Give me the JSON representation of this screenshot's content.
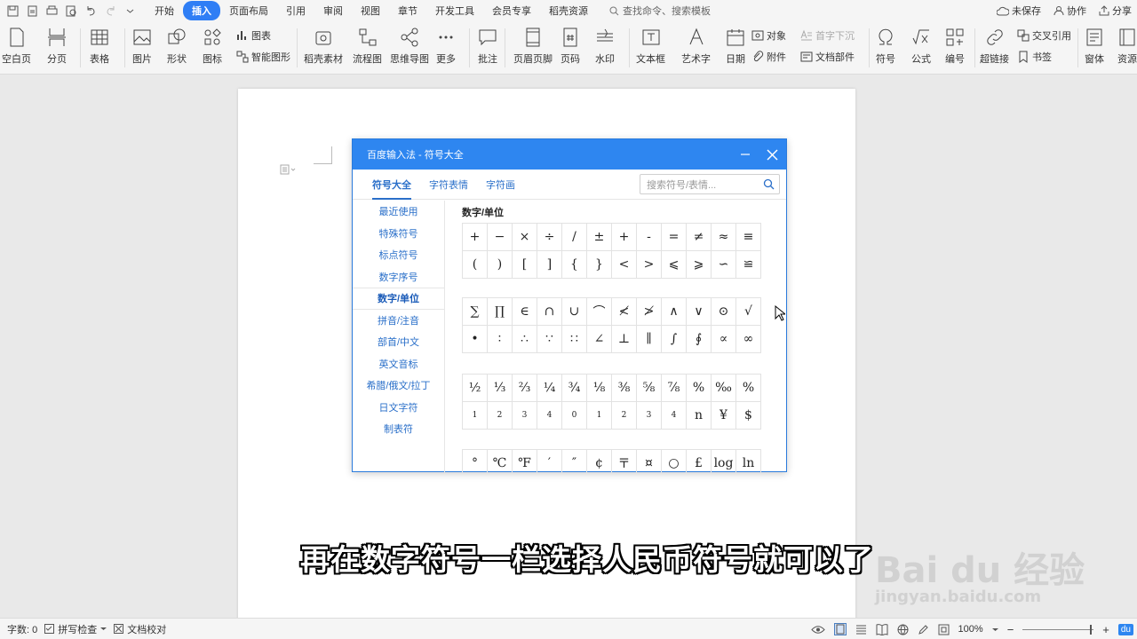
{
  "menubar": {
    "tabs": [
      "开始",
      "插入",
      "页面布局",
      "引用",
      "审阅",
      "视图",
      "章节",
      "开发工具",
      "会员专享",
      "稻壳资源"
    ],
    "active_tab": "插入",
    "search_placeholder": "查找命令、搜索模板",
    "unsaved": "未保存",
    "collab": "协作",
    "share": "分享"
  },
  "ribbon": {
    "blank_page": "空白页",
    "page_break": "分页",
    "table": "表格",
    "picture": "图片",
    "shape": "形状",
    "icon_lib": "图标",
    "chart": "图表",
    "smart_art": "智能图形",
    "daoke": "稻壳素材",
    "flowchart": "流程图",
    "mindmap": "思维导图",
    "more": "更多",
    "comment": "批注",
    "header_footer": "页眉页脚",
    "page_number": "页码",
    "watermark": "水印",
    "textbox": "文本框",
    "wordart": "艺术字",
    "date": "日期",
    "object": "对象",
    "dropcap": "首字下沉",
    "attachment": "附件",
    "doc_parts": "文档部件",
    "symbol": "符号",
    "formula": "公式",
    "numbering": "编号",
    "hyperlink": "超链接",
    "cross_ref": "交叉引用",
    "bookmark": "书签",
    "window": "窗体",
    "resources": "资源"
  },
  "dialog": {
    "title": "百度输入法 - 符号大全",
    "tabs": [
      "符号大全",
      "字符表情",
      "字符画"
    ],
    "search_placeholder": "搜索符号/表情...",
    "categories": [
      "最近使用",
      "特殊符号",
      "标点符号",
      "数字序号",
      "数字/单位",
      "拼音/注音",
      "部首/中文",
      "英文音标",
      "希腊/俄文/拉丁",
      "日文字符",
      "制表符"
    ],
    "active_category": "数字/单位",
    "section_title": "数字/单位",
    "rows": [
      [
        "+",
        "−",
        "×",
        "÷",
        "/",
        "±",
        "+",
        "-",
        "=",
        "≠",
        "≈",
        "≡"
      ],
      [
        "(",
        ")",
        "[",
        "]",
        "{",
        "}",
        "<",
        ">",
        "⩽",
        "⩾",
        "∽",
        "≌"
      ],
      [
        "∑",
        "∏",
        "∈",
        "∩",
        "∪",
        "⌒",
        "≮",
        "≯",
        "∧",
        "∨",
        "⊙",
        "√"
      ],
      [
        "•",
        "∶",
        "∴",
        "∵",
        "∷",
        "∠",
        "⊥",
        "∥",
        "∫",
        "∮",
        "∝",
        "∞"
      ],
      [
        "½",
        "⅓",
        "⅔",
        "¼",
        "¾",
        "⅛",
        "⅜",
        "⅝",
        "⅞",
        "%",
        "‰",
        "%"
      ],
      [
        "1",
        "2",
        "3",
        "4",
        "0",
        "1",
        "2",
        "3",
        "4",
        "n",
        "¥",
        "$"
      ],
      [
        "°",
        "℃",
        "℉",
        "′",
        "″",
        "¢",
        "〒",
        "¤",
        "○",
        "£",
        "log",
        "ln"
      ]
    ]
  },
  "subtitle": "再在数字符号一栏选择人民币符号就可以了",
  "watermark": {
    "logo": "Bai du 经验",
    "url": "jingyan.baidu.com"
  },
  "statusbar": {
    "word_count": "字数: 0",
    "spellcheck": "拼写检查",
    "doc_check": "文档校对",
    "zoom": "100%"
  },
  "colors": {
    "accent": "#2e86f0",
    "link": "#2a6fc9"
  }
}
